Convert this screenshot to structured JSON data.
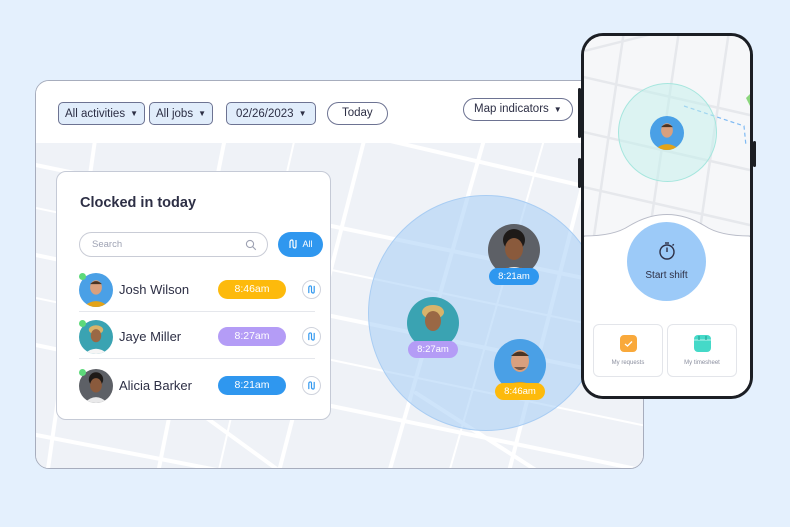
{
  "toolbar": {
    "filters": [
      {
        "label": "All activities",
        "icon": "caret-down-icon"
      },
      {
        "label": "All jobs",
        "icon": "caret-down-icon"
      },
      {
        "label": "02/26/2023",
        "icon": "caret-down-icon"
      }
    ],
    "today_label": "Today",
    "map_indicators_label": "Map indicators",
    "caret": "▼"
  },
  "panel": {
    "title": "Clocked in today",
    "search_placeholder": "Search",
    "all_label": "All",
    "employees": [
      {
        "name": "Josh Wilson",
        "time": "8:46am",
        "color": "#fdba0c",
        "status": "online"
      },
      {
        "name": "Jaye Miller",
        "time": "8:27am",
        "color": "#b49cf6",
        "status": "online"
      },
      {
        "name": "Alicia Barker",
        "time": "8:21am",
        "color": "#2f97ef",
        "status": "online"
      }
    ]
  },
  "map_pins": [
    {
      "name": "Alicia Barker",
      "time": "8:21am",
      "color": "#2f97ef"
    },
    {
      "name": "Jaye Miller",
      "time": "8:27am",
      "color": "#b49cf6"
    },
    {
      "name": "Josh Wilson",
      "time": "8:46am",
      "color": "#fdba0c"
    }
  ],
  "phone": {
    "start_label": "Start shift",
    "tiles": [
      {
        "label": "My requests",
        "icon": "check-square-icon",
        "color": "#f9a93b"
      },
      {
        "label": "My timesheet",
        "icon": "calendar-icon",
        "color": "#45d9c8"
      }
    ]
  },
  "colors": {
    "background": "#e4f0fd",
    "accent": "#2f97ef",
    "online": "#5dd97a"
  }
}
